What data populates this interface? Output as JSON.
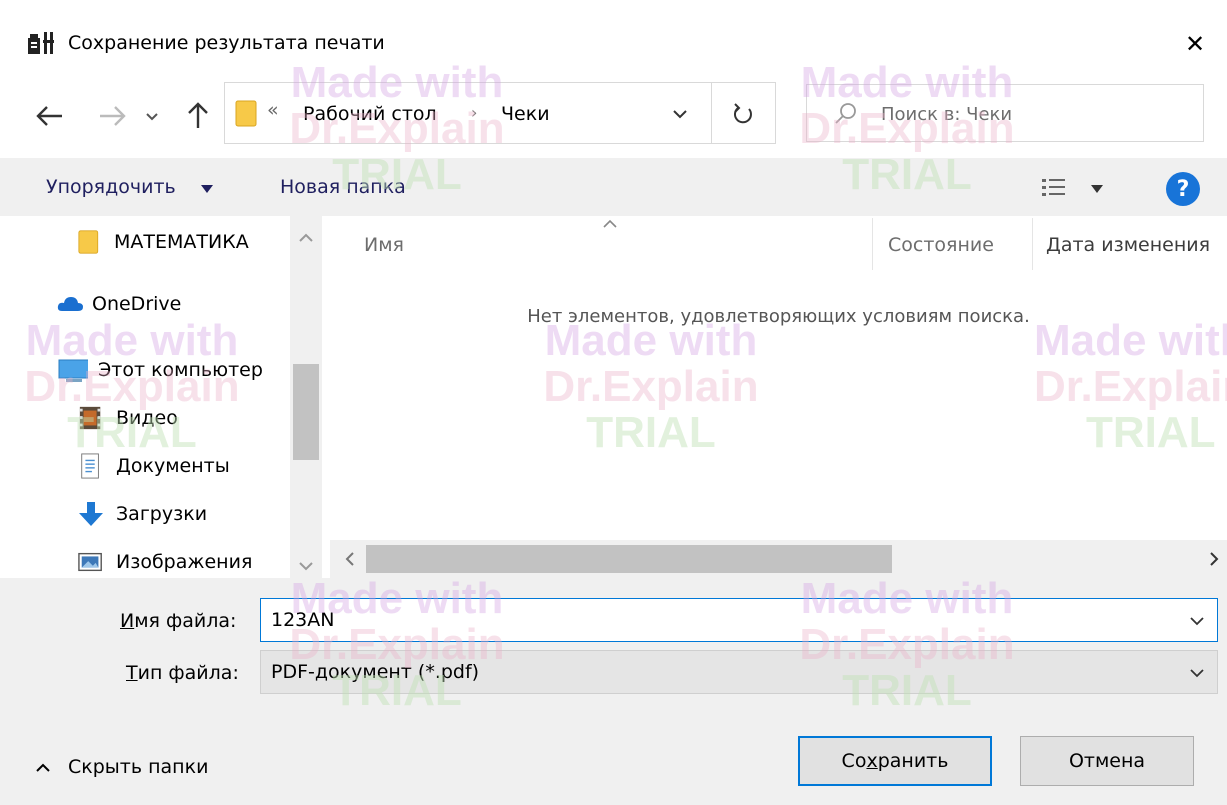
{
  "window": {
    "title": "Сохранение результата печати",
    "close_glyph": "✕"
  },
  "nav": {
    "back_icon": "arrow-left-icon",
    "forward_icon": "arrow-right-icon",
    "up_icon": "arrow-up-icon"
  },
  "address": {
    "overflow_glyph": "«",
    "crumbs": [
      "Рабочий стол",
      "Чеки"
    ],
    "separator": "›"
  },
  "search": {
    "placeholder": "Поиск в: Чеки"
  },
  "toolbar": {
    "organize_label": "Упорядочить",
    "new_folder_label": "Новая папка",
    "help_label": "?"
  },
  "navpane": {
    "items": [
      {
        "label": "МАТЕМАТИКА",
        "icon": "folder-icon"
      },
      {
        "label": "OneDrive",
        "icon": "cloud-icon"
      },
      {
        "label": "Этот компьютер",
        "icon": "computer-icon"
      },
      {
        "label": "Видео",
        "icon": "video-icon"
      },
      {
        "label": "Документы",
        "icon": "documents-icon"
      },
      {
        "label": "Загрузки",
        "icon": "download-icon"
      },
      {
        "label": "Изображения",
        "icon": "images-icon"
      }
    ]
  },
  "filelist": {
    "columns": [
      "Имя",
      "Состояние",
      "Дата изменения"
    ],
    "empty_message": "Нет элементов, удовлетворяющих условиям поиска."
  },
  "form": {
    "filename_label_u": "И",
    "filename_label_rest": "мя файла:",
    "filename_value": "123AN",
    "filetype_label_u": "Т",
    "filetype_label_rest": "ип файла:",
    "filetype_value": "PDF-документ (*.pdf)"
  },
  "footer": {
    "hide_folders_label": "Скрыть папки",
    "save_pre": "Со",
    "save_u": "х",
    "save_post": "ранить",
    "cancel_label": "Отмена"
  },
  "watermark": {
    "line1": "Made with",
    "line2": "Dr.Explain",
    "line3": "TRIAL"
  },
  "colors": {
    "accent": "#0078d7",
    "help": "#1874d8",
    "toolbar_bg": "#f0f0f0"
  }
}
